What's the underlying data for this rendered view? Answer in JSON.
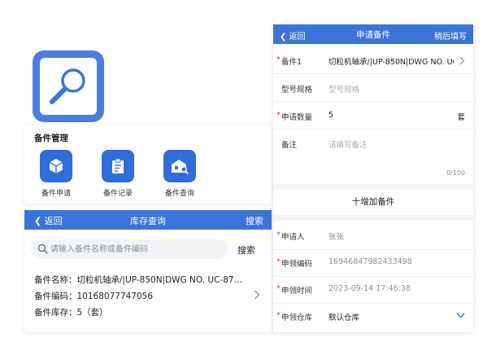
{
  "colors": {
    "brand_blue": "#3b73d9",
    "icon_blue": "#2f6ed8",
    "required_red": "#e0382f"
  },
  "app_icon": {
    "icon": "magnifier-icon"
  },
  "management": {
    "title": "备件管理",
    "items": [
      {
        "label": "备件申请",
        "icon": "box-icon"
      },
      {
        "label": "备件记录",
        "icon": "clipboard-icon"
      },
      {
        "label": "备件查询",
        "icon": "warehouse-search-icon"
      }
    ]
  },
  "inventory": {
    "back_label": "返回",
    "title": "库存查询",
    "header_action": "搜索",
    "search": {
      "placeholder": "请输入备件名称或备件编码",
      "value": "",
      "button_label": "搜索"
    },
    "result": {
      "name_line": "备件名称：切粒机轴承/|UP-850N|DWG NO. UC-87…",
      "code_line": "备件编码：10168077747056",
      "stock_line": "备件库存：5（套）"
    }
  },
  "form": {
    "back_label": "返回",
    "title": "申请备件",
    "header_action": "稍后填写",
    "part": {
      "label": "备件1",
      "value": "切粒机轴承/|UP-850N|DWG NO. UC"
    },
    "model": {
      "label": "型号规格",
      "placeholder": "型号规格"
    },
    "quantity": {
      "label": "申请数量",
      "value": "5",
      "unit": "套"
    },
    "note": {
      "label": "备注",
      "placeholder": "请填写备注",
      "counter": "0/100"
    },
    "add_part_label": "十增加备件",
    "applicant": {
      "label": "申请人",
      "value": "张张"
    },
    "request_code": {
      "label": "申领编码",
      "value": "16946847982433498"
    },
    "request_time": {
      "label": "申领时间",
      "value": "2023-09-14 17:46:38"
    },
    "warehouse": {
      "label": "申领仓库",
      "value": "默认仓库"
    }
  }
}
